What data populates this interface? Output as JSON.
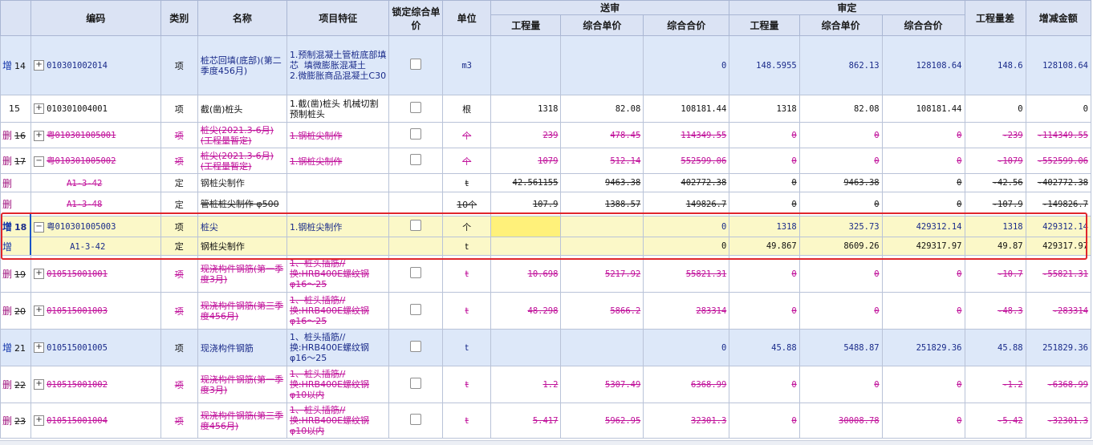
{
  "columns": {
    "code": "编码",
    "type": "类别",
    "name": "名称",
    "feature": "项目特征",
    "lock": "锁定综合单价",
    "unit": "单位",
    "submitted": "送审",
    "reviewed": "审定",
    "qty": "工程量",
    "unit_price": "综合单价",
    "total_price": "综合合价",
    "qty_diff": "工程量差",
    "amount_diff": "增减金额"
  },
  "rows": [
    {
      "idx": "14",
      "tag": "增",
      "code": "010301002014",
      "type": "项",
      "name": "桩芯回填(底部)(第二季度456月)",
      "feature": "1.预制混凝土管桩底部填芯  填微膨胀混凝土\n2.微膨胀商品混凝土C30",
      "unit": "m3",
      "s_qty": "",
      "s_price": "",
      "s_total": "0",
      "r_qty": "148.5955",
      "r_price": "862.13",
      "r_total": "128108.64",
      "diff_qty": "148.6",
      "diff_amt": "128108.64"
    },
    {
      "idx": "15",
      "tag": "",
      "code": "010301004001",
      "type": "项",
      "name": "截(凿)桩头",
      "feature": "1.截(凿)桩头 机械切割预制桩头",
      "unit": "根",
      "s_qty": "1318",
      "s_price": "82.08",
      "s_total": "108181.44",
      "r_qty": "1318",
      "r_price": "82.08",
      "r_total": "108181.44",
      "diff_qty": "0",
      "diff_amt": "0"
    },
    {
      "idx": "16",
      "tag": "删",
      "code": "粤010301005001",
      "type": "项",
      "name": "桩尖(2021.3-6月)(工程量暂定)",
      "feature": "1.钢桩尖制作",
      "unit": "个",
      "s_qty": "239",
      "s_price": "478.45",
      "s_total": "114349.55",
      "r_qty": "0",
      "r_price": "0",
      "r_total": "0",
      "diff_qty": "-239",
      "diff_amt": "-114349.55"
    },
    {
      "idx": "17",
      "tag": "删",
      "code": "粤010301005002",
      "type": "项",
      "name": "桩尖(2021.3-6月)(工程量暂定)",
      "feature": "1.钢桩尖制作",
      "unit": "个",
      "s_qty": "1079",
      "s_price": "512.14",
      "s_total": "552599.06",
      "r_qty": "0",
      "r_price": "0",
      "r_total": "0",
      "diff_qty": "-1079",
      "diff_amt": "-552599.06"
    },
    {
      "idx": "",
      "tag": "删",
      "code": "A1-3-42",
      "type": "定",
      "name": "钢桩尖制作",
      "feature": "",
      "unit": "t",
      "s_qty": "42.561155",
      "s_price": "9463.38",
      "s_total": "402772.38",
      "r_qty": "0",
      "r_price": "9463.38",
      "r_total": "0",
      "diff_qty": "-42.56",
      "diff_amt": "-402772.38"
    },
    {
      "idx": "",
      "tag": "删",
      "code": "A1-3-48",
      "type": "定",
      "name": "管桩桩尖制作 φ500",
      "feature": "",
      "unit": "10个",
      "s_qty": "107.9",
      "s_price": "1388.57",
      "s_total": "149826.7",
      "r_qty": "0",
      "r_price": "0",
      "r_total": "0",
      "diff_qty": "-107.9",
      "diff_amt": "-149826.7"
    },
    {
      "idx": "18",
      "tag": "增",
      "code": "粤010301005003",
      "type": "项",
      "name": "桩尖",
      "feature": "1.钢桩尖制作",
      "unit": "个",
      "s_qty": "",
      "s_price": "",
      "s_total": "0",
      "r_qty": "1318",
      "r_price": "325.73",
      "r_total": "429312.14",
      "diff_qty": "1318",
      "diff_amt": "429312.14"
    },
    {
      "idx": "",
      "tag": "增",
      "code": "A1-3-42",
      "type": "定",
      "name": "钢桩尖制作",
      "feature": "",
      "unit": "t",
      "s_qty": "",
      "s_price": "",
      "s_total": "0",
      "r_qty": "49.867",
      "r_price": "8609.26",
      "r_total": "429317.97",
      "diff_qty": "49.87",
      "diff_amt": "429317.97"
    },
    {
      "idx": "19",
      "tag": "删",
      "code": "010515001001",
      "type": "项",
      "name": "现浇构件钢筋(第一季度3月)",
      "feature": "1、桩头插筋//换:HRB400E螺纹钢 φ16～25",
      "unit": "t",
      "s_qty": "10.698",
      "s_price": "5217.92",
      "s_total": "55821.31",
      "r_qty": "0",
      "r_price": "0",
      "r_total": "0",
      "diff_qty": "-10.7",
      "diff_amt": "-55821.31"
    },
    {
      "idx": "20",
      "tag": "删",
      "code": "010515001003",
      "type": "项",
      "name": "现浇构件钢筋(第三季度456月)",
      "feature": "1、桩头插筋//换:HRB400E螺纹钢 φ16～25",
      "unit": "t",
      "s_qty": "48.298",
      "s_price": "5866.2",
      "s_total": "283314",
      "r_qty": "0",
      "r_price": "0",
      "r_total": "0",
      "diff_qty": "-48.3",
      "diff_amt": "-283314"
    },
    {
      "idx": "21",
      "tag": "增",
      "code": "010515001005",
      "type": "项",
      "name": "现浇构件钢筋",
      "feature": "1、桩头插筋//换:HRB400E螺纹钢 φ16～25",
      "unit": "t",
      "s_qty": "",
      "s_price": "",
      "s_total": "0",
      "r_qty": "45.88",
      "r_price": "5488.87",
      "r_total": "251829.36",
      "diff_qty": "45.88",
      "diff_amt": "251829.36"
    },
    {
      "idx": "22",
      "tag": "删",
      "code": "010515001002",
      "type": "项",
      "name": "现浇构件钢筋(第一季度3月)",
      "feature": "1、桩头插筋//换:HRB400E螺纹钢 φ10以内",
      "unit": "t",
      "s_qty": "1.2",
      "s_price": "5307.49",
      "s_total": "6368.99",
      "r_qty": "0",
      "r_price": "0",
      "r_total": "0",
      "diff_qty": "-1.2",
      "diff_amt": "-6368.99"
    },
    {
      "idx": "23",
      "tag": "删",
      "code": "010515001004",
      "type": "项",
      "name": "现浇构件钢筋(第三季度456月)",
      "feature": "1、桩头插筋//换:HRB400E螺纹钢 φ10以内",
      "unit": "t",
      "s_qty": "5.417",
      "s_price": "5962.95",
      "s_total": "32301.3",
      "r_qty": "0",
      "r_price": "30008.78",
      "r_total": "0",
      "diff_qty": "-5.42",
      "diff_amt": "-32301.3"
    }
  ]
}
